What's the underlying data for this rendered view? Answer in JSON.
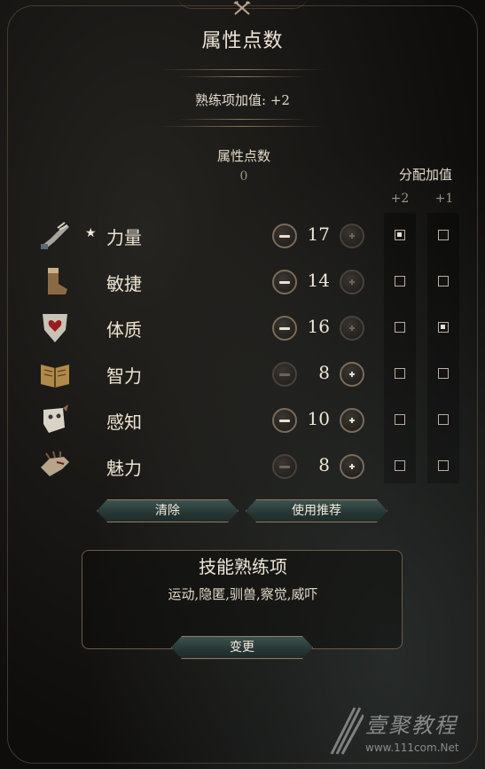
{
  "window": {
    "title": "属性点数",
    "proficiency_bonus": "熟练项加值: +2"
  },
  "points": {
    "label": "属性点数",
    "value": "0"
  },
  "allocation": {
    "title": "分配加值",
    "col_plus2": "+2",
    "col_plus1": "+1"
  },
  "abilities": [
    {
      "name": "力量",
      "icon": "gauntlet-icon",
      "value": "17",
      "starred": true,
      "minus_enabled": true,
      "plus_enabled": false,
      "plus2": true,
      "plus1": false
    },
    {
      "name": "敏捷",
      "icon": "boot-icon",
      "value": "14",
      "starred": false,
      "minus_enabled": true,
      "plus_enabled": false,
      "plus2": false,
      "plus1": false
    },
    {
      "name": "体质",
      "icon": "shield-heart-icon",
      "value": "16",
      "starred": false,
      "minus_enabled": true,
      "plus_enabled": false,
      "plus2": false,
      "plus1": true
    },
    {
      "name": "智力",
      "icon": "book-icon",
      "value": "8",
      "starred": false,
      "minus_enabled": false,
      "plus_enabled": true,
      "plus2": false,
      "plus1": false
    },
    {
      "name": "感知",
      "icon": "mask-icon",
      "value": "10",
      "starred": false,
      "minus_enabled": true,
      "plus_enabled": true,
      "plus2": false,
      "plus1": false
    },
    {
      "name": "魅力",
      "icon": "hand-icon",
      "value": "8",
      "starred": false,
      "minus_enabled": false,
      "plus_enabled": true,
      "plus2": false,
      "plus1": false
    }
  ],
  "star_glyph": "★",
  "buttons": {
    "clear": "清除",
    "recommend": "使用推荐",
    "change": "变更"
  },
  "skills": {
    "title": "技能熟练项",
    "list": "运动,隐匿,驯兽,察觉,威吓"
  },
  "watermark": {
    "brand": "壹聚教程",
    "url": "www.111com.Net"
  },
  "colors": {
    "accent_gold": "#8f7d60",
    "button_teal": "#2f4341",
    "text_light": "#efe6d6"
  }
}
